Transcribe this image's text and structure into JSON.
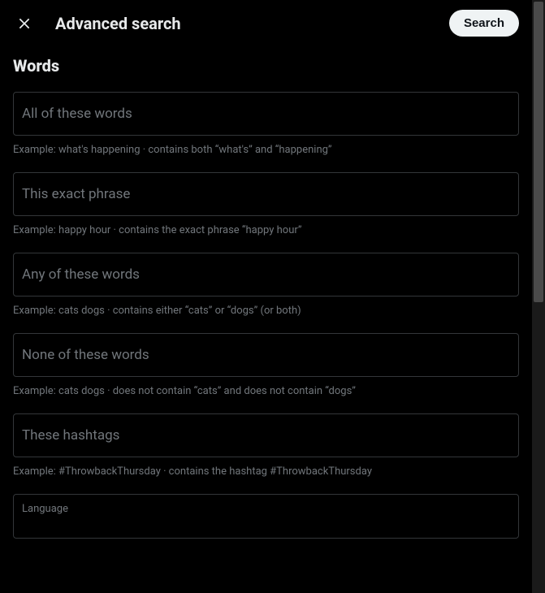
{
  "header": {
    "title": "Advanced search",
    "search_button": "Search"
  },
  "section": {
    "title": "Words"
  },
  "fields": {
    "all_words": {
      "label": "All of these words",
      "hint": "Example: what's happening · contains both “what's” and “happening”"
    },
    "exact_phrase": {
      "label": "This exact phrase",
      "hint": "Example: happy hour · contains the exact phrase “happy hour”"
    },
    "any_words": {
      "label": "Any of these words",
      "hint": "Example: cats dogs · contains either “cats” or “dogs” (or both)"
    },
    "none_words": {
      "label": "None of these words",
      "hint": "Example: cats dogs · does not contain “cats” and does not contain “dogs”"
    },
    "hashtags": {
      "label": "These hashtags",
      "hint": "Example: #ThrowbackThursday · contains the hashtag #ThrowbackThursday"
    },
    "language": {
      "label": "Language"
    }
  }
}
